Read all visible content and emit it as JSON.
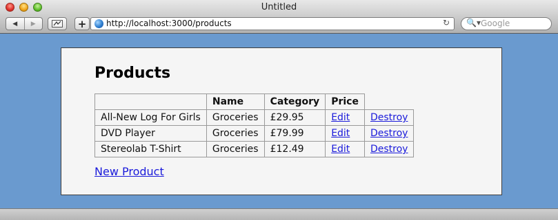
{
  "window": {
    "title": "Untitled"
  },
  "toolbar": {
    "url": "http://localhost:3000/products",
    "search_placeholder": "Google",
    "back_glyph": "◀",
    "forward_glyph": "▶",
    "add_glyph": "+",
    "reload_glyph": "↻",
    "search_glyph": "🔍▾"
  },
  "page": {
    "heading": "Products",
    "table": {
      "headers": [
        "",
        "Name",
        "Category",
        "Price"
      ],
      "rows": [
        {
          "name": "All-New Log For Girls",
          "category": "Groceries",
          "price": "£29.95",
          "edit": "Edit",
          "destroy": "Destroy"
        },
        {
          "name": "DVD Player",
          "category": "Groceries",
          "price": "£79.99",
          "edit": "Edit",
          "destroy": "Destroy"
        },
        {
          "name": "Stereolab T-Shirt",
          "category": "Groceries",
          "price": "£12.49",
          "edit": "Edit",
          "destroy": "Destroy"
        }
      ]
    },
    "new_link": "New Product"
  },
  "colors": {
    "desktop_bg": "#6a9acf",
    "page_bg": "#f5f5f5",
    "link": "#1a1adb"
  }
}
